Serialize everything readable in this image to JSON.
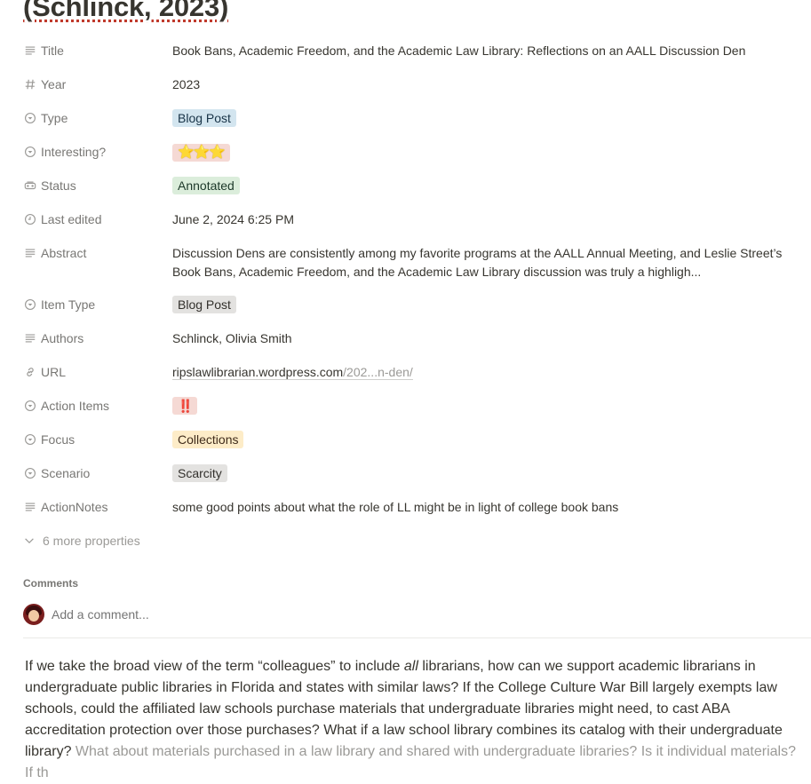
{
  "page": {
    "title": "(Schlinck, 2023)"
  },
  "properties": [
    {
      "name": "Title",
      "icon": "text-lines-icon",
      "kind": "text",
      "value": "Book Bans, Academic Freedom, and the Academic Law Library: Reflections on an AALL Discussion Den"
    },
    {
      "name": "Year",
      "icon": "hash-icon",
      "kind": "text",
      "value": "2023"
    },
    {
      "name": "Type",
      "icon": "select-icon",
      "kind": "tag",
      "value": "Blog Post",
      "color": "#d3e5ef"
    },
    {
      "name": "Interesting?",
      "icon": "select-icon",
      "kind": "tag",
      "value": "⭐⭐⭐",
      "color": "#f5d9d4"
    },
    {
      "name": "Status",
      "icon": "status-icon",
      "kind": "tag",
      "value": "Annotated",
      "color": "#dbeddb"
    },
    {
      "name": "Last edited",
      "icon": "clock-icon",
      "kind": "text",
      "value": "June 2, 2024 6:25 PM"
    },
    {
      "name": "Abstract",
      "icon": "text-lines-icon",
      "kind": "text",
      "value": "Discussion Dens are consistently among my favorite programs at the AALL Annual Meeting, and Leslie Street’s Book Bans, Academic Freedom, and the Academic Law Library discussion was truly a highligh..."
    },
    {
      "name": "Item Type",
      "icon": "select-icon",
      "kind": "tag",
      "value": "Blog Post",
      "color": "#e3e2e0"
    },
    {
      "name": "Authors",
      "icon": "text-lines-icon",
      "kind": "text",
      "value": "Schlinck, Olivia Smith"
    },
    {
      "name": "URL",
      "icon": "link-icon",
      "kind": "url",
      "value": "ripslawlibrarian.wordpress.com",
      "value_rest": "/202...n-den/"
    },
    {
      "name": "Action Items",
      "icon": "select-icon",
      "kind": "tag",
      "value": "‼️",
      "color": "#f5d9d4"
    },
    {
      "name": "Focus",
      "icon": "select-icon",
      "kind": "tag",
      "value": "Collections",
      "color": "#fdecc8"
    },
    {
      "name": "Scenario",
      "icon": "select-icon",
      "kind": "tag",
      "value": "Scarcity",
      "color": "#e3e2e0"
    },
    {
      "name": "ActionNotes",
      "icon": "text-lines-icon",
      "kind": "text",
      "value": "some good points about what the role of LL might be in light of college book bans"
    }
  ],
  "more_properties": {
    "label": "6 more properties"
  },
  "comments": {
    "heading": "Comments",
    "placeholder": "Add a comment..."
  },
  "body": {
    "p1_a": "If we take the broad view of the term “colleagues” to include ",
    "p1_em": "all",
    "p1_b": " librarians, how can we support academic librarians in undergraduate public libraries in Florida and states with similar laws? If the College Culture War Bill largely exempts law schools, could the affiliated law schools purchase materials that undergraduate libraries might need, to cast ABA accreditation protection over those purchases? What if a law school library combines its catalog with their undergraduate library?",
    "p1_muted": " What about materials purchased in a law library and shared with undergraduate libraries? Is it individual materials? If th"
  }
}
